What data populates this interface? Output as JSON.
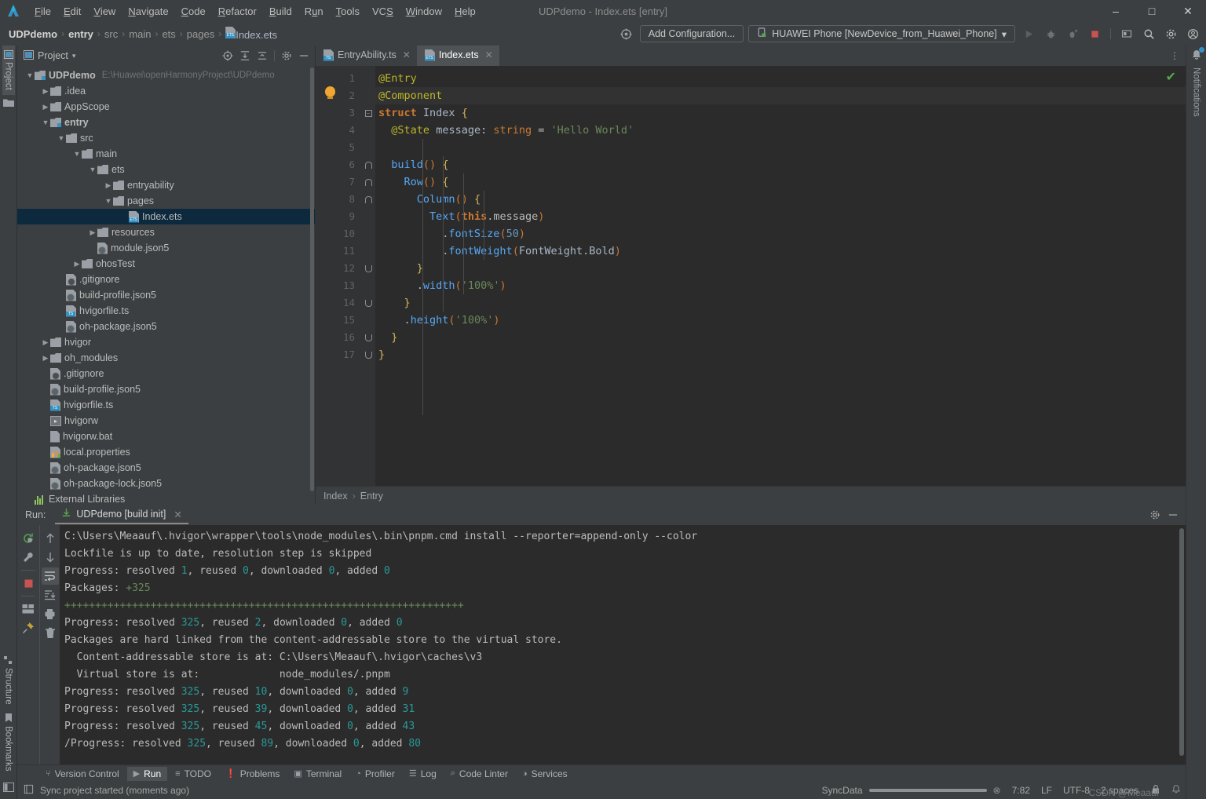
{
  "window": {
    "title": "UDPdemo - Index.ets [entry]",
    "minimize": "–",
    "maximize": "□",
    "close": "✕"
  },
  "menubar": {
    "items": [
      {
        "label": "File",
        "mnemonic": "F"
      },
      {
        "label": "Edit",
        "mnemonic": "E"
      },
      {
        "label": "View",
        "mnemonic": "V"
      },
      {
        "label": "Navigate",
        "mnemonic": "N"
      },
      {
        "label": "Code",
        "mnemonic": "C"
      },
      {
        "label": "Refactor",
        "mnemonic": "R"
      },
      {
        "label": "Build",
        "mnemonic": "B"
      },
      {
        "label": "Run",
        "mnemonic": "u"
      },
      {
        "label": "Tools",
        "mnemonic": "T"
      },
      {
        "label": "VCS",
        "mnemonic": "S"
      },
      {
        "label": "Window",
        "mnemonic": "W"
      },
      {
        "label": "Help",
        "mnemonic": "H"
      }
    ]
  },
  "navbar": {
    "breadcrumbs": [
      {
        "label": "UDPdemo",
        "style": "bold"
      },
      {
        "label": "entry",
        "style": "bold"
      },
      {
        "label": "src",
        "style": "dim"
      },
      {
        "label": "main",
        "style": "dim"
      },
      {
        "label": "ets",
        "style": "dim"
      },
      {
        "label": "pages",
        "style": "dim"
      },
      {
        "label": "Index.ets",
        "style": "file"
      }
    ],
    "separator": "›",
    "add_configuration": "Add Configuration...",
    "device": "HUAWEI Phone [NewDevice_from_Huawei_Phone]",
    "device_caret": "▾",
    "icons": [
      "target-icon",
      "run-icon",
      "debug-icon",
      "profile-icon",
      "stop-icon",
      "device-manager-icon",
      "search-icon",
      "settings-icon",
      "account-icon"
    ]
  },
  "left_strip": {
    "top": [
      {
        "label": "Project",
        "selected": true
      }
    ],
    "bottom": [
      {
        "label": "Structure"
      },
      {
        "label": "Bookmarks"
      }
    ]
  },
  "right_strip": {
    "items": [
      {
        "label": "Notifications",
        "badge": true
      }
    ]
  },
  "project_panel": {
    "title": "Project",
    "caret": "▾",
    "tools": [
      "select-opened-file-icon",
      "expand-all-icon",
      "collapse-all-icon",
      "settings-icon",
      "hide-icon"
    ],
    "tree": [
      {
        "indent": 0,
        "arrow": "v",
        "icon": "module-folder",
        "name": "UDPdemo",
        "bold": true,
        "path": "E:\\Huawei\\openHarmonyProject\\UDPdemo"
      },
      {
        "indent": 1,
        "arrow": ">",
        "icon": "folder",
        "name": ".idea"
      },
      {
        "indent": 1,
        "arrow": ">",
        "icon": "folder",
        "name": "AppScope"
      },
      {
        "indent": 1,
        "arrow": "v",
        "icon": "module-folder",
        "name": "entry",
        "bold": true
      },
      {
        "indent": 2,
        "arrow": "v",
        "icon": "folder",
        "name": "src"
      },
      {
        "indent": 3,
        "arrow": "v",
        "icon": "folder",
        "name": "main"
      },
      {
        "indent": 4,
        "arrow": "v",
        "icon": "folder",
        "name": "ets"
      },
      {
        "indent": 5,
        "arrow": ">",
        "icon": "folder",
        "name": "entryability"
      },
      {
        "indent": 5,
        "arrow": "v",
        "icon": "folder",
        "name": "pages"
      },
      {
        "indent": 6,
        "arrow": "",
        "icon": "ets-file",
        "name": "Index.ets",
        "selected": true
      },
      {
        "indent": 4,
        "arrow": ">",
        "icon": "folder",
        "name": "resources"
      },
      {
        "indent": 4,
        "arrow": "",
        "icon": "json5-file",
        "name": "module.json5"
      },
      {
        "indent": 3,
        "arrow": ">",
        "icon": "folder",
        "name": "ohosTest"
      },
      {
        "indent": 2,
        "arrow": "",
        "icon": "gitignore-file",
        "name": ".gitignore"
      },
      {
        "indent": 2,
        "arrow": "",
        "icon": "json5-file",
        "name": "build-profile.json5"
      },
      {
        "indent": 2,
        "arrow": "",
        "icon": "ts-file",
        "name": "hvigorfile.ts"
      },
      {
        "indent": 2,
        "arrow": "",
        "icon": "json5-file",
        "name": "oh-package.json5"
      },
      {
        "indent": 1,
        "arrow": ">",
        "icon": "folder",
        "name": "hvigor"
      },
      {
        "indent": 1,
        "arrow": ">",
        "icon": "folder",
        "name": "oh_modules"
      },
      {
        "indent": 1,
        "arrow": "",
        "icon": "gitignore-file",
        "name": ".gitignore"
      },
      {
        "indent": 1,
        "arrow": "",
        "icon": "json5-file",
        "name": "build-profile.json5"
      },
      {
        "indent": 1,
        "arrow": "",
        "icon": "ts-file",
        "name": "hvigorfile.ts"
      },
      {
        "indent": 1,
        "arrow": "",
        "icon": "script-file",
        "name": "hvigorw"
      },
      {
        "indent": 1,
        "arrow": "",
        "icon": "bat-file",
        "name": "hvigorw.bat"
      },
      {
        "indent": 1,
        "arrow": "",
        "icon": "properties-file",
        "name": "local.properties"
      },
      {
        "indent": 1,
        "arrow": "",
        "icon": "json5-file",
        "name": "oh-package.json5"
      },
      {
        "indent": 1,
        "arrow": "",
        "icon": "json5-file",
        "name": "oh-package-lock.json5"
      },
      {
        "indent": 0,
        "arrow": "",
        "icon": "library-icon",
        "name": "External Libraries"
      }
    ]
  },
  "editor": {
    "tabs": [
      {
        "label": "EntryAbility.ts",
        "icon": "ts-file",
        "active": false,
        "close": "✕"
      },
      {
        "label": "Index.ets",
        "icon": "ets-file",
        "active": true,
        "close": "✕"
      }
    ],
    "more": "⋮",
    "inspection_status": "✔",
    "breadcrumb": [
      "Index",
      "Entry"
    ],
    "breadcrumb_sep": "›",
    "line_numbers": [
      1,
      2,
      3,
      4,
      5,
      6,
      7,
      8,
      9,
      10,
      11,
      12,
      13,
      14,
      15,
      16,
      17
    ],
    "code_text": "@Entry\n@Component\nstruct Index {\n  @State message: string = 'Hello World'\n\n  build() {\n    Row() {\n      Column() {\n        Text(this.message)\n          .fontSize(50)\n          .fontWeight(FontWeight.Bold)\n      }\n      .width('100%')\n    }\n    .height('100%')\n  }\n}"
  },
  "run_panel": {
    "label": "Run:",
    "tab": "UDPdemo [build init]",
    "tab_close": "✕",
    "tools_left": [
      "rerun-icon",
      "wrench-icon",
      "stop-icon",
      "layout-icon",
      "pin-icon"
    ],
    "tools_right": [
      "up-arrow-icon",
      "down-arrow-icon",
      "soft-wrap-icon",
      "scroll-to-end-icon",
      "print-icon",
      "trash-icon"
    ],
    "head_tools": [
      "settings-icon",
      "hide-icon"
    ],
    "console_lines": [
      {
        "text": "C:\\Users\\Meaauf\\.hvigor\\wrapper\\tools\\node_modules\\.bin\\pnpm.cmd install --reporter=append-only --color"
      },
      {
        "text": "Lockfile is up to date, resolution step is skipped"
      },
      {
        "text": "Progress: resolved 1, reused 0, downloaded 0, added 0",
        "nums": [
          [
            18,
            1
          ],
          [
            27,
            0
          ],
          [
            41,
            0
          ],
          [
            51,
            0
          ]
        ]
      },
      {
        "text": "Packages: +325",
        "green_from": 10
      },
      {
        "text": "+++++++++++++++++++++++++++++++++++++++++++++++++++++++++++++++++",
        "all_green": true
      },
      {
        "text": "Progress: resolved 325, reused 2, downloaded 0, added 0"
      },
      {
        "text": "Packages are hard linked from the content-addressable store to the virtual store."
      },
      {
        "text": "  Content-addressable store is at: C:\\Users\\Meaauf\\.hvigor\\caches\\v3"
      },
      {
        "text": "  Virtual store is at:             node_modules/.pnpm"
      },
      {
        "text": "Progress: resolved 325, reused 10, downloaded 0, added 9"
      },
      {
        "text": "Progress: resolved 325, reused 39, downloaded 0, added 31"
      },
      {
        "text": "Progress: resolved 325, reused 45, downloaded 0, added 43"
      },
      {
        "text": "/Progress: resolved 325, reused 89, downloaded 0, added 80"
      }
    ]
  },
  "bottom_tabs": [
    {
      "label": "Version Control",
      "icon": "branch-icon",
      "selected": false
    },
    {
      "label": "Run",
      "icon": "play-icon",
      "selected": true
    },
    {
      "label": "TODO",
      "icon": "list-icon",
      "selected": false
    },
    {
      "label": "Problems",
      "icon": "warning-icon",
      "selected": false
    },
    {
      "label": "Terminal",
      "icon": "terminal-icon",
      "selected": false
    },
    {
      "label": "Profiler",
      "icon": "gauge-icon",
      "selected": false
    },
    {
      "label": "Log",
      "icon": "log-icon",
      "selected": false
    },
    {
      "label": "Code Linter",
      "icon": "magnifier-icon",
      "selected": false
    },
    {
      "label": "Services",
      "icon": "services-icon",
      "selected": false
    }
  ],
  "statusbar": {
    "message": "Sync project started (moments ago)",
    "sync_data": "SyncData",
    "sync_cancel": "⊗",
    "caret_position": "7:82",
    "line_separator": "LF",
    "encoding": "UTF-8",
    "indent": "2 spaces",
    "watermark": "CSDN @Meaauf"
  },
  "colors": {
    "accent": "#3592c4",
    "selection": "#0d293e",
    "editor_bg": "#2b2b2b",
    "panel_bg": "#3c3f41",
    "gutter_bg": "#313335",
    "ok_green": "#5aa44f",
    "console_cyan": "#299999",
    "console_green": "#6a8759",
    "stop_red": "#c75450"
  }
}
